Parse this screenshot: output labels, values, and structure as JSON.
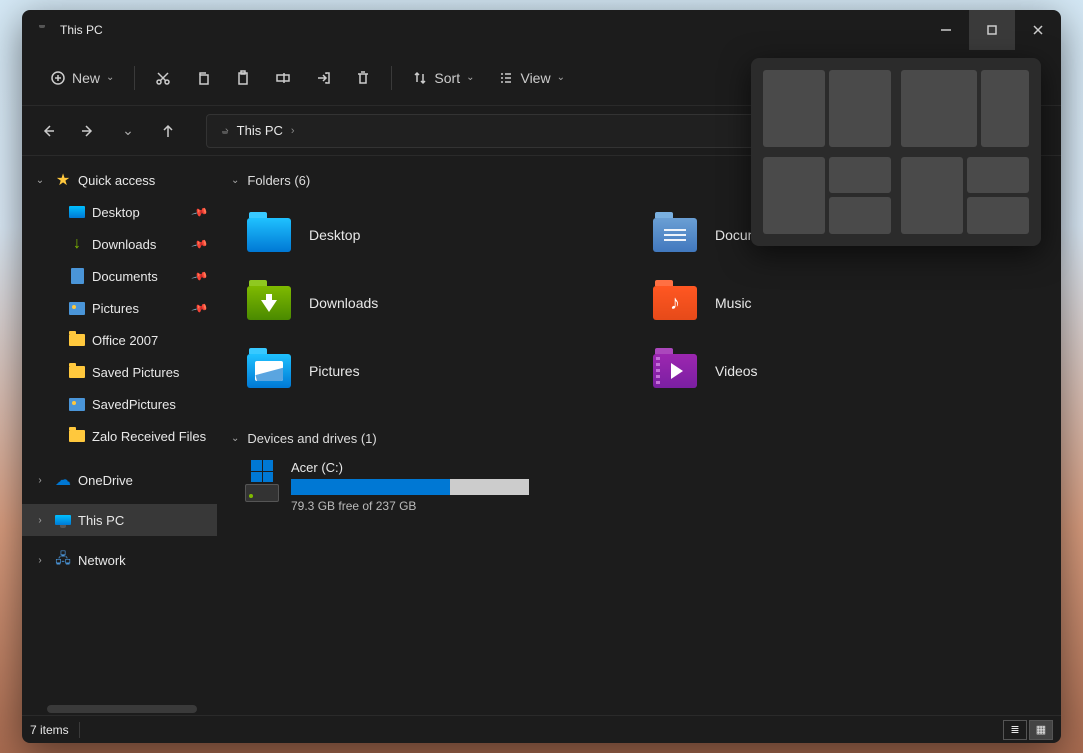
{
  "title": "This PC",
  "toolbar": {
    "new": "New",
    "sort": "Sort",
    "view": "View"
  },
  "address": "This PC",
  "sidebar": {
    "quickAccess": "Quick access",
    "items": [
      {
        "label": "Desktop",
        "pinned": true,
        "type": "desk"
      },
      {
        "label": "Downloads",
        "pinned": true,
        "type": "dl"
      },
      {
        "label": "Documents",
        "pinned": true,
        "type": "doc"
      },
      {
        "label": "Pictures",
        "pinned": true,
        "type": "pic"
      },
      {
        "label": "Office 2007",
        "pinned": false,
        "type": "folder"
      },
      {
        "label": "Saved Pictures",
        "pinned": false,
        "type": "folder"
      },
      {
        "label": "SavedPictures",
        "pinned": false,
        "type": "pic"
      },
      {
        "label": "Zalo Received Files",
        "pinned": false,
        "type": "folder"
      }
    ],
    "onedrive": "OneDrive",
    "thispc": "This PC",
    "network": "Network"
  },
  "groups": {
    "foldersHead": "Folders (6)",
    "drivesHead": "Devices and drives (1)",
    "folders": [
      {
        "label": "Desktop",
        "type": "desktop"
      },
      {
        "label": "Documents",
        "type": "docs"
      },
      {
        "label": "Downloads",
        "type": "dl"
      },
      {
        "label": "Music",
        "type": "music"
      },
      {
        "label": "Pictures",
        "type": "pics"
      },
      {
        "label": "Videos",
        "type": "video"
      }
    ],
    "drive": {
      "label": "Acer (C:)",
      "free": "79.3 GB free of 237 GB",
      "fill_percent": 67
    }
  },
  "status": {
    "items": "7 items"
  }
}
